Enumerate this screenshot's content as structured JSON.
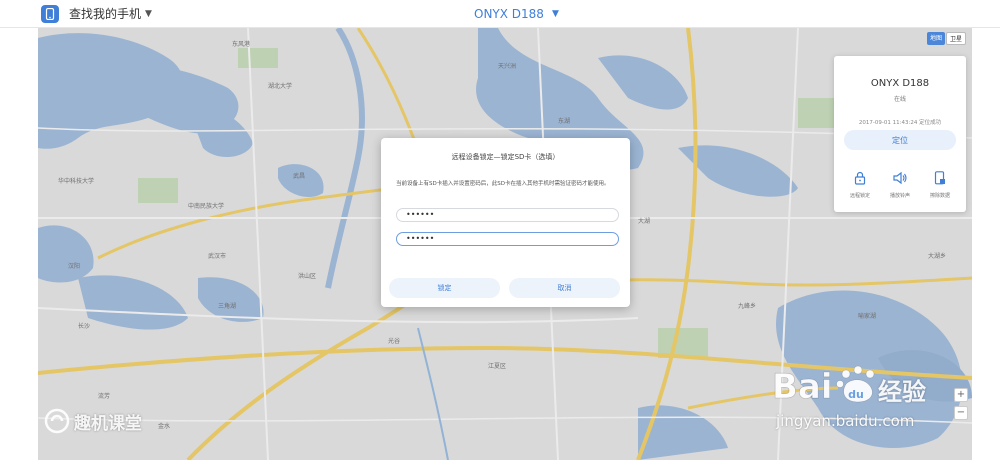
{
  "header": {
    "app_title": "查找我的手机",
    "device_selected": "ONYX D188"
  },
  "map": {
    "type_buttons": [
      "地图",
      "卫星"
    ],
    "labels": [
      "东风港",
      "长沙",
      "武汉市",
      "洪山区",
      "武昌",
      "汉阳",
      "江夏区",
      "大湖乡",
      "光谷",
      "中南民族大学",
      "华中科技大学",
      "湖北大学",
      "九峰乡",
      "流芳",
      "金水",
      "三角湖",
      "天兴洲",
      "东湖",
      "大湖",
      "喻家湖"
    ],
    "colors": {
      "land": "#ececec",
      "water": "#a9c4e4",
      "road": "#ffffff",
      "major_road": "#f8d770",
      "green": "#cfe3c2"
    }
  },
  "panel": {
    "device_name": "ONYX D188",
    "status": "在线",
    "time": "2017-09-01 11:43:24 定位成功",
    "locate_label": "定位",
    "actions": [
      {
        "icon": "lock-icon",
        "label": "远程锁定"
      },
      {
        "icon": "speaker-icon",
        "label": "播放铃声"
      },
      {
        "icon": "erase-icon",
        "label": "擦除数据"
      }
    ]
  },
  "dialog": {
    "title": "远程设备锁定—锁定SD卡（选填）",
    "description": "当前设备上有SD卡插入并设置密码后，此SD卡在插入其他手机时需验证密码才能使用。",
    "password_value": "••••••",
    "confirm_value": "••••••",
    "lock_button": "锁定",
    "cancel_button": "取消"
  },
  "watermark": {
    "left_text": "趣机课堂",
    "baidu_text": "经验",
    "url": "jingyan.baidu.com"
  },
  "zoom": {
    "in": "+",
    "out": "−"
  }
}
